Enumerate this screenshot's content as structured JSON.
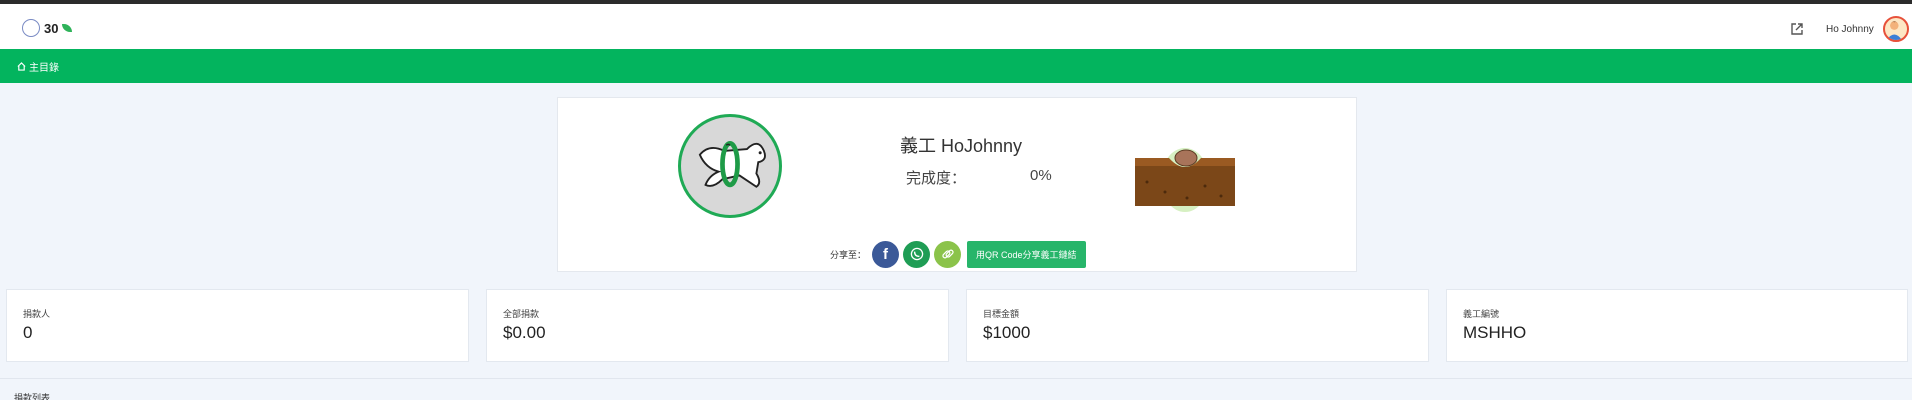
{
  "header": {
    "logo_text": "30",
    "username": "Ho Johnny"
  },
  "nav": {
    "home_label": "主目錄"
  },
  "profile": {
    "name": "義工 HoJohnny",
    "completion_label": "完成度：",
    "completion_value": "0%",
    "share_label": "分享至：",
    "facebook_glyph": "f",
    "qr_button": "用QR Code分享義工鏈結"
  },
  "stats": [
    {
      "label": "捐款人",
      "value": "0"
    },
    {
      "label": "全部捐款",
      "value": "$0.00"
    },
    {
      "label": "目標金額",
      "value": "$1000"
    },
    {
      "label": "義工編號",
      "value": "MSHHO"
    }
  ],
  "donor_list_title": "捐款列表",
  "colors": {
    "nav_green": "#03b45e",
    "button_green": "#27b56a",
    "facebook_blue": "#3b5998",
    "whatsapp_green": "#1f9d55",
    "link_green": "#8bc34a"
  },
  "icons": [
    "external-link-icon",
    "home-icon",
    "facebook-icon",
    "whatsapp-icon",
    "link-icon"
  ]
}
